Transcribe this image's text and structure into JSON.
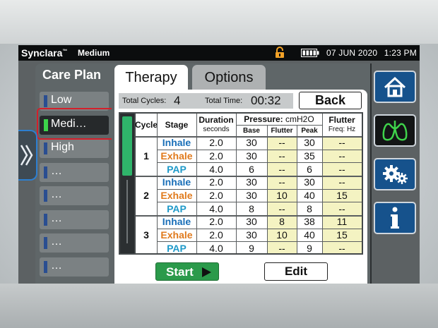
{
  "status_bar": {
    "app_name": "Synclara",
    "trademark": "™",
    "mode": "Medium",
    "date": "07 JUN 2020",
    "time": "1:23 PM"
  },
  "care_plan": {
    "title": "Care Plan",
    "items": [
      {
        "label": "Low",
        "selected": false
      },
      {
        "label": "Medi…",
        "selected": true
      },
      {
        "label": "High",
        "selected": false
      },
      {
        "label": "…",
        "selected": false
      },
      {
        "label": "…",
        "selected": false
      },
      {
        "label": "…",
        "selected": false
      },
      {
        "label": "…",
        "selected": false
      },
      {
        "label": "…",
        "selected": false
      }
    ]
  },
  "tabs": [
    {
      "label": "Therapy",
      "active": true
    },
    {
      "label": "Options",
      "active": false
    }
  ],
  "totals": {
    "cycles_label": "Total Cycles:",
    "cycles_value": "4",
    "time_label": "Total Time:",
    "time_value": "00:32"
  },
  "back_label": "Back",
  "table": {
    "headers": {
      "cycle": "Cycle",
      "stage": "Stage",
      "duration": "Duration",
      "duration_unit": "seconds",
      "pressure": "Pressure:",
      "pressure_unit": "cmH2O",
      "base": "Base",
      "flutter": "Flutter",
      "peak": "Peak",
      "flutter_freq": "Flutter",
      "flutter_freq_unit": "Freq: Hz"
    },
    "cycles": [
      {
        "number": "1",
        "rows": [
          {
            "stage": "Inhale",
            "duration": "2.0",
            "base": "30",
            "flutter": "--",
            "peak": "30",
            "freq": "--"
          },
          {
            "stage": "Exhale",
            "duration": "2.0",
            "base": "30",
            "flutter": "--",
            "peak": "35",
            "freq": "--"
          },
          {
            "stage": "PAP",
            "duration": "4.0",
            "base": "6",
            "flutter": "--",
            "peak": "6",
            "freq": "--"
          }
        ]
      },
      {
        "number": "2",
        "rows": [
          {
            "stage": "Inhale",
            "duration": "2.0",
            "base": "30",
            "flutter": "--",
            "peak": "30",
            "freq": "--"
          },
          {
            "stage": "Exhale",
            "duration": "2.0",
            "base": "30",
            "flutter": "10",
            "peak": "40",
            "freq": "15"
          },
          {
            "stage": "PAP",
            "duration": "4.0",
            "base": "8",
            "flutter": "--",
            "peak": "8",
            "freq": "--"
          }
        ]
      },
      {
        "number": "3",
        "rows": [
          {
            "stage": "Inhale",
            "duration": "2.0",
            "base": "30",
            "flutter": "8",
            "peak": "38",
            "freq": "11"
          },
          {
            "stage": "Exhale",
            "duration": "2.0",
            "base": "30",
            "flutter": "10",
            "peak": "40",
            "freq": "15"
          },
          {
            "stage": "PAP",
            "duration": "4.0",
            "base": "9",
            "flutter": "--",
            "peak": "9",
            "freq": "--"
          }
        ]
      }
    ]
  },
  "actions": {
    "start_label": "Start",
    "edit_label": "Edit"
  },
  "nav_icons": [
    "home-icon",
    "lungs-icon",
    "settings-gears-icon",
    "info-icon"
  ],
  "colors": {
    "inhale": "#1a6fb8",
    "exhale": "#e07a1c",
    "pap": "#1f9ac9",
    "selected_marker": "#3cd34a",
    "start_button": "#2b9a4b",
    "nav_button": "#16528c",
    "highlight": "#d41f2a"
  }
}
